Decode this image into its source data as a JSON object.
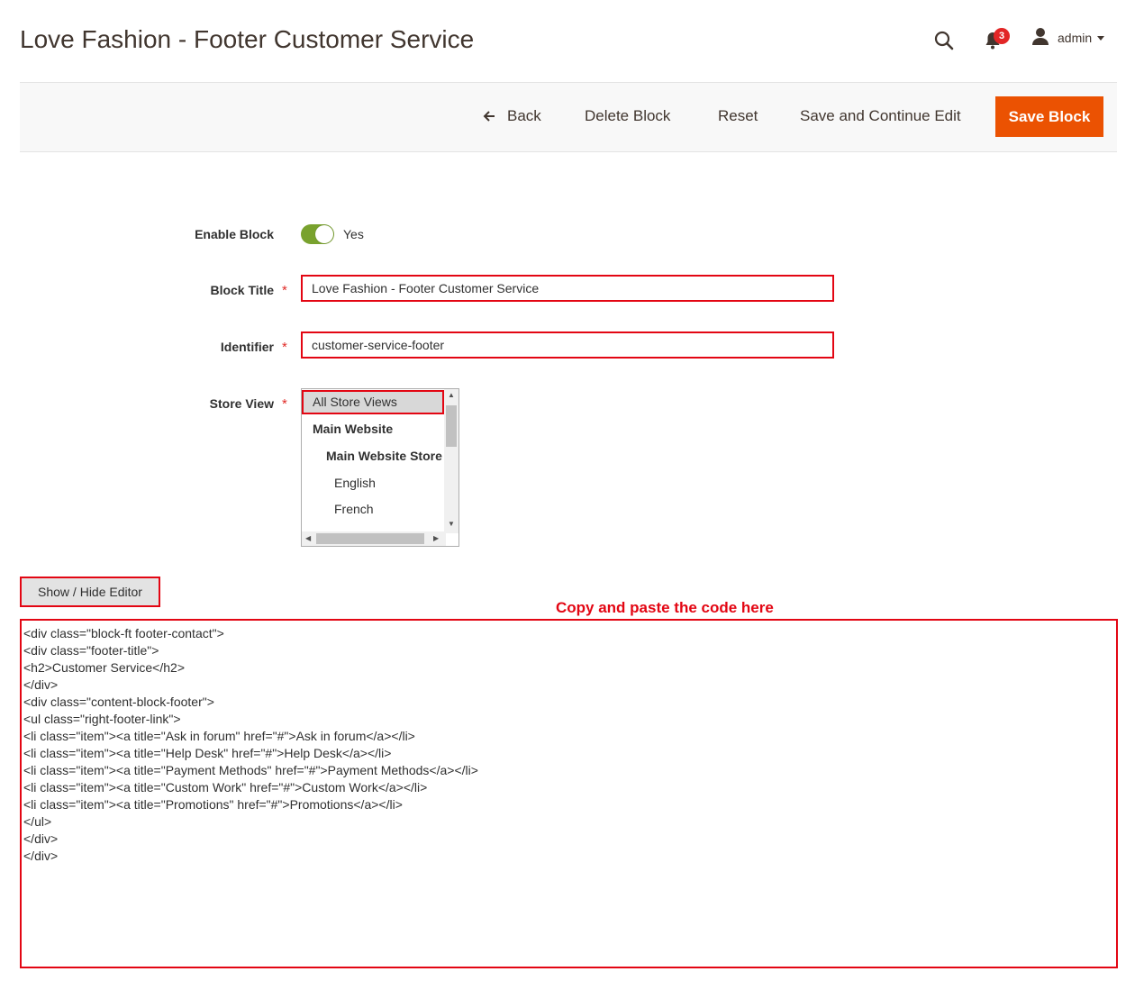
{
  "header": {
    "title": "Love Fashion - Footer Customer Service",
    "notifications_count": "3",
    "user_name": "admin"
  },
  "toolbar": {
    "back_label": "Back",
    "delete_label": "Delete Block",
    "reset_label": "Reset",
    "save_continue_label": "Save and Continue Edit",
    "save_label": "Save Block"
  },
  "form": {
    "enable_block": {
      "label": "Enable Block",
      "value": "Yes",
      "enabled": true
    },
    "block_title": {
      "label": "Block Title",
      "value": "Love Fashion - Footer Customer Service"
    },
    "identifier": {
      "label": "Identifier",
      "value": "customer-service-footer"
    },
    "store_view": {
      "label": "Store View",
      "options": [
        "All Store Views",
        "Main Website",
        "Main Website Store",
        "English",
        "French"
      ],
      "selected": "All Store Views"
    },
    "required_mark": "*"
  },
  "editor": {
    "toggle_label": "Show / Hide Editor",
    "annotation": "Copy and paste the code here",
    "content": "<div class=\"block-ft footer-contact\">\n<div class=\"footer-title\">\n<h2>Customer Service</h2>\n</div>\n<div class=\"content-block-footer\">\n<ul class=\"right-footer-link\">\n<li class=\"item\"><a title=\"Ask in forum\" href=\"#\">Ask in forum</a></li>\n<li class=\"item\"><a title=\"Help Desk\" href=\"#\">Help Desk</a></li>\n<li class=\"item\"><a title=\"Payment Methods\" href=\"#\">Payment Methods</a></li>\n<li class=\"item\"><a title=\"Custom Work\" href=\"#\">Custom Work</a></li>\n<li class=\"item\"><a title=\"Promotions\" href=\"#\">Promotions</a></li>\n</ul>\n</div>\n</div>"
  },
  "colors": {
    "accent": "#eb5202",
    "toggle_on": "#79a22e",
    "highlight_border": "#e30613",
    "badge": "#e22626"
  }
}
